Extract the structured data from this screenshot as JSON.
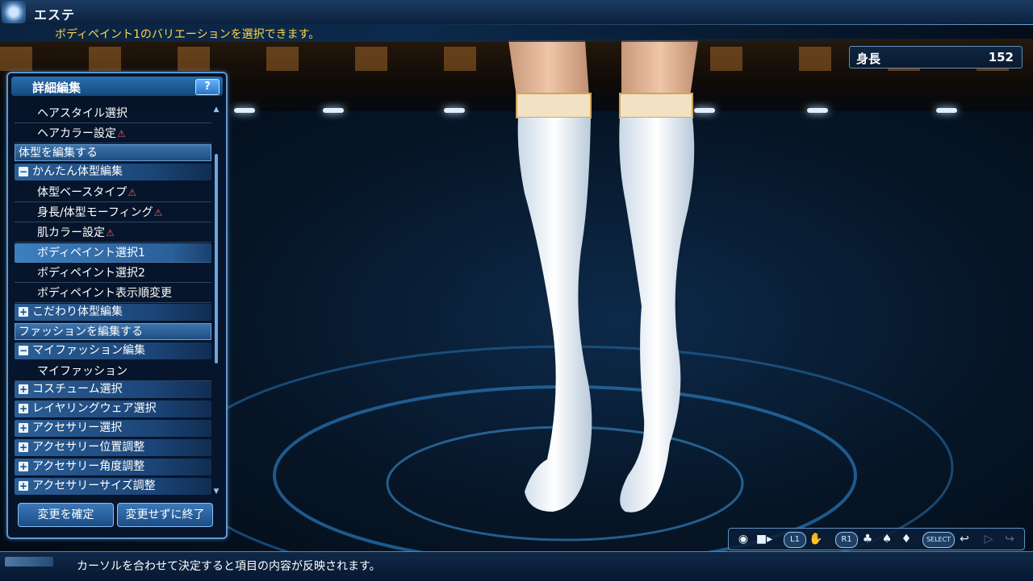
{
  "window": {
    "title": "エステ"
  },
  "header": {
    "hint": "ボディペイント1のバリエーションを選択できます。"
  },
  "height_readout": {
    "label": "身長",
    "value": "152"
  },
  "panel": {
    "title": "詳細編集",
    "help_label": "?",
    "rows": [
      {
        "kind": "item",
        "label": "ヘアスタイル選択",
        "warn": false
      },
      {
        "kind": "item",
        "label": "ヘアカラー設定",
        "warn": true
      },
      {
        "kind": "section",
        "label": "体型を編集する"
      },
      {
        "kind": "group",
        "label": "かんたん体型編集",
        "icon": "minus"
      },
      {
        "kind": "item",
        "label": "体型ベースタイプ",
        "warn": true
      },
      {
        "kind": "item",
        "label": "身長/体型モーフィング",
        "warn": true
      },
      {
        "kind": "item",
        "label": "肌カラー設定",
        "warn": true
      },
      {
        "kind": "item",
        "label": "ボディペイント選択1",
        "warn": false,
        "selected": true
      },
      {
        "kind": "item",
        "label": "ボディペイント選択2",
        "warn": false
      },
      {
        "kind": "item",
        "label": "ボディペイント表示順変更",
        "warn": false
      },
      {
        "kind": "group",
        "label": "こだわり体型編集",
        "icon": "plus"
      },
      {
        "kind": "section",
        "label": "ファッションを編集する"
      },
      {
        "kind": "group",
        "label": "マイファッション編集",
        "icon": "minus"
      },
      {
        "kind": "item",
        "label": "マイファッション",
        "warn": false
      },
      {
        "kind": "group",
        "label": "コスチューム選択",
        "icon": "plus"
      },
      {
        "kind": "group",
        "label": "レイヤリングウェア選択",
        "icon": "plus"
      },
      {
        "kind": "group",
        "label": "アクセサリー選択",
        "icon": "plus"
      },
      {
        "kind": "group",
        "label": "アクセサリー位置調整",
        "icon": "plus"
      },
      {
        "kind": "group",
        "label": "アクセサリー角度調整",
        "icon": "plus"
      },
      {
        "kind": "group",
        "label": "アクセサリーサイズ調整",
        "icon": "plus"
      }
    ],
    "confirm_label": "変更を確定",
    "quit_label": "変更せずに終了"
  },
  "controls": {
    "l1": "L1",
    "r1": "R1",
    "select": "SELECT"
  },
  "footer": {
    "hint": "カーソルを合わせて決定すると項目の内容が反映されます。"
  },
  "colors": {
    "accent": "#5f9ad0",
    "hint_yellow": "#ffd84a",
    "warn": "#ff5a5a"
  }
}
